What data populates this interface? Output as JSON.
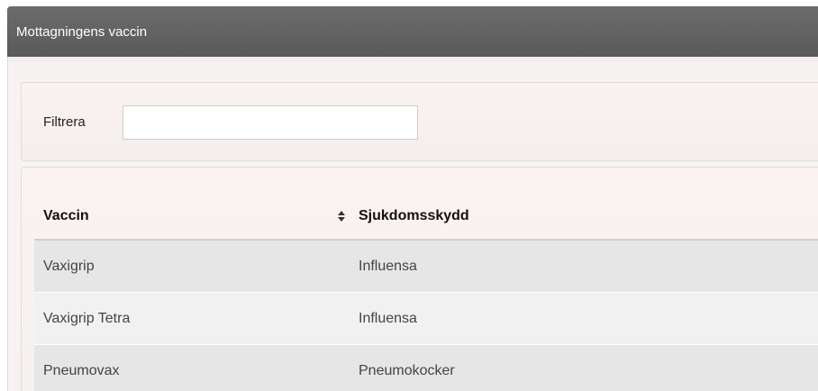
{
  "panel": {
    "title": "Mottagningens vaccin"
  },
  "filter": {
    "label": "Filtrera",
    "value": "",
    "placeholder": ""
  },
  "table": {
    "columns": [
      {
        "label": "Vaccin",
        "sortable": true,
        "sort_icon": "sort-up-down-icon"
      },
      {
        "label": "Sjukdomsskydd"
      }
    ],
    "rows": [
      {
        "vaccin": "Vaxigrip",
        "skydd": "Influensa"
      },
      {
        "vaccin": "Vaxigrip Tetra",
        "skydd": "Influensa"
      },
      {
        "vaccin": "Pneumovax",
        "skydd": "Pneumokocker"
      }
    ]
  },
  "colors": {
    "header_bg": "#5f5f5f",
    "odd_row": "#e6e6e6",
    "even_row": "#f1f1f1",
    "panel_bg": "#f7f3f2"
  }
}
